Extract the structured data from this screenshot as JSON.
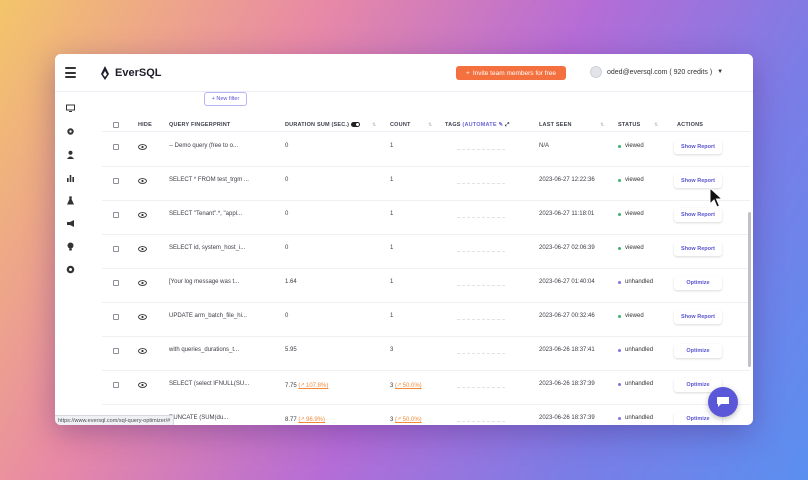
{
  "app": {
    "name": "EverSQL",
    "invite_label": "Invite team members for free",
    "user_label": "oded@eversql.com ( 920 credits )"
  },
  "sidebar": {
    "icons": [
      "monitor-icon",
      "gear-icon",
      "user-icon",
      "bar-chart-icon",
      "flask-icon",
      "megaphone-icon",
      "lightbulb-icon",
      "lifebuoy-icon"
    ]
  },
  "filters": {
    "new_filter_label": "+ New filter"
  },
  "table": {
    "headers": {
      "hide": "HIDE",
      "fingerprint": "QUERY FINGERPRINT",
      "duration": "DURATION SUM (SEC.)",
      "count": "COUNT",
      "tags": "TAGS",
      "tags_auto": "(AUTOMATE",
      "last_seen": "LAST SEEN",
      "status": "STATUS",
      "actions": "ACTIONS"
    },
    "rows": [
      {
        "fingerprint": "-- Demo query (free to o...",
        "duration": "0",
        "duration_change": "",
        "count": "1",
        "count_change": "",
        "last_seen": "N/A",
        "status": "viewed",
        "action": "Show Report"
      },
      {
        "fingerprint": "SELECT * FROM test_trgm ...",
        "duration": "0",
        "duration_change": "",
        "count": "1",
        "count_change": "",
        "last_seen": "2023-06-27 12:22:36",
        "status": "viewed",
        "action": "Show Report"
      },
      {
        "fingerprint": "SELECT \"Tenant\".*, \"appl...",
        "duration": "0",
        "duration_change": "",
        "count": "1",
        "count_change": "",
        "last_seen": "2023-06-27 11:18:01",
        "status": "viewed",
        "action": "Show Report"
      },
      {
        "fingerprint": "SELECT id, system_host_i...",
        "duration": "0",
        "duration_change": "",
        "count": "1",
        "count_change": "",
        "last_seen": "2023-06-27 02:06:39",
        "status": "viewed",
        "action": "Show Report"
      },
      {
        "fingerprint": "[Your log message was t...",
        "duration": "1.64",
        "duration_change": "",
        "count": "1",
        "count_change": "",
        "last_seen": "2023-06-27 01:40:04",
        "status": "unhandled",
        "action": "Optimize"
      },
      {
        "fingerprint": "UPDATE arm_batch_file_hi...",
        "duration": "0",
        "duration_change": "",
        "count": "1",
        "count_change": "",
        "last_seen": "2023-06-27 00:32:46",
        "status": "viewed",
        "action": "Show Report"
      },
      {
        "fingerprint": "with queries_durations_t...",
        "duration": "5.95",
        "duration_change": "",
        "count": "3",
        "count_change": "",
        "last_seen": "2023-06-26 18:37:41",
        "status": "unhandled",
        "action": "Optimize"
      },
      {
        "fingerprint": "SELECT (select IFNULL(SU...",
        "duration": "7.75",
        "duration_change": "107.8%",
        "count": "3",
        "count_change": "50.0%",
        "last_seen": "2023-06-26 18:37:39",
        "status": "unhandled",
        "action": "Optimize"
      },
      {
        "fingerprint": "RUNCATE (SUM(du...",
        "duration": "8.77",
        "duration_change": "96.9%",
        "count": "3",
        "count_change": "50.0%",
        "last_seen": "2023-06-26 18:37:39",
        "status": "unhandled",
        "action": "Optimize"
      }
    ]
  },
  "statusbar": {
    "url": "https://www.eversql.com/sql-query-optimizer/#"
  },
  "colors": {
    "accent": "#5b57d9",
    "invite": "#f4713f",
    "viewed": "#39b56a",
    "unhandled": "#8a6fe0",
    "change": "#f08a3a"
  }
}
